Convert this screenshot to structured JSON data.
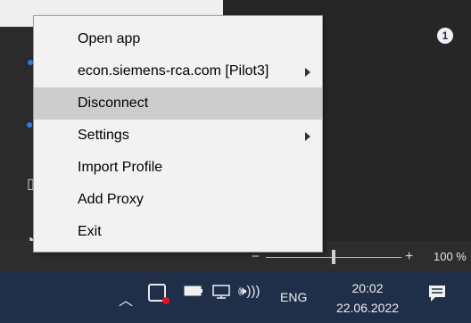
{
  "menu": {
    "items": [
      {
        "label": "Open app",
        "submenu": false,
        "highlighted": false
      },
      {
        "label": "econ.siemens-rca.com [Pilot3]",
        "submenu": true,
        "highlighted": false
      },
      {
        "label": "Disconnect",
        "submenu": false,
        "highlighted": true
      },
      {
        "label": "Settings",
        "submenu": true,
        "highlighted": false
      },
      {
        "label": "Import Profile",
        "submenu": false,
        "highlighted": false
      },
      {
        "label": "Add Proxy",
        "submenu": false,
        "highlighted": false
      },
      {
        "label": "Exit",
        "submenu": false,
        "highlighted": false
      }
    ]
  },
  "zoom": {
    "minus": "−",
    "plus": "+",
    "percent": "100 %",
    "level": 0.5
  },
  "taskbar": {
    "tray_icons": [
      "chevron-up-icon",
      "app-tray-icon",
      "battery-icon",
      "network-icon",
      "volume-icon"
    ],
    "language": "ENG",
    "time": "20:02",
    "date": "22.06.2022",
    "notification_count": "1"
  },
  "colors": {
    "menu_background": "#f2f2f2",
    "menu_highlight": "#cccccc",
    "taskbar": "#1f2f4a",
    "status_dot": "#e81123"
  }
}
